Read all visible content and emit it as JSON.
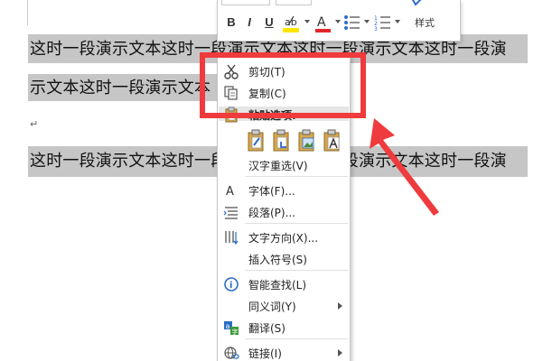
{
  "document": {
    "line1": "这时一段演示文本这时一段演示文本这时一段演示文本这时一段演",
    "line2": "示文本这时一段演示文本",
    "line3": "这时一段演示文本这时一段演示文本这时一段演示文本这时一段演",
    "paragraph_mark": "↵",
    "selection_color": "#c6c6c6"
  },
  "mini_toolbar": {
    "bold_label": "B",
    "italic_label": "I",
    "underline_label": "U",
    "styles_label": "样式",
    "font_color": "#e0282a",
    "highlight_color": "#ffe600"
  },
  "context_menu": {
    "items": [
      {
        "label": "剪切(T)",
        "icon": "scissors-icon"
      },
      {
        "label": "复制(C)",
        "icon": "copy-icon"
      },
      {
        "label": "粘贴选项:",
        "icon": "clipboard-icon"
      },
      {
        "label": "汉字重选(V)",
        "icon": ""
      },
      {
        "label": "字体(F)...",
        "icon": "font-icon"
      },
      {
        "label": "段落(P)...",
        "icon": "paragraph-icon"
      },
      {
        "label": "文字方向(X)...",
        "icon": "text-direction-icon"
      },
      {
        "label": "插入符号(S)",
        "icon": ""
      },
      {
        "label": "智能查找(L)",
        "icon": "smart-lookup-icon"
      },
      {
        "label": "同义词(Y)",
        "icon": "",
        "submenu": true
      },
      {
        "label": "翻译(S)",
        "icon": "translate-icon"
      },
      {
        "label": "链接(I)",
        "icon": "link-icon",
        "submenu": true
      }
    ],
    "paste_options": [
      "keep-source-formatting-icon",
      "merge-formatting-icon",
      "picture-paste-icon",
      "keep-text-only-icon"
    ]
  },
  "annotation": {
    "box_color": "#ef3b3d",
    "arrow_color": "#ef3b3d"
  }
}
